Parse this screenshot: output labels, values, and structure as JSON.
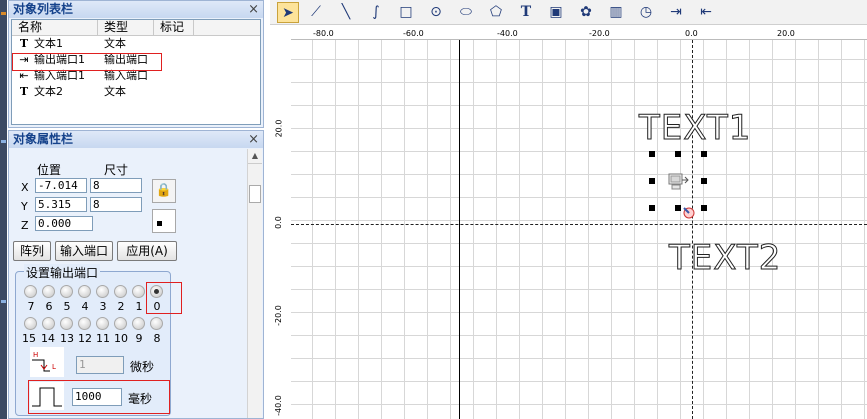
{
  "object_list": {
    "title": "对象列表栏",
    "close": "×",
    "columns": [
      "名称",
      "类型",
      "标记"
    ],
    "rows": [
      {
        "icon": "T",
        "name": "文本1",
        "type": "文本"
      },
      {
        "icon": "⇥",
        "name": "输出端口1",
        "type": "输出端口"
      },
      {
        "icon": "⇤",
        "name": "输入端口1",
        "type": "输入端口"
      },
      {
        "icon": "T",
        "name": "文本2",
        "type": "文本"
      }
    ]
  },
  "properties": {
    "title": "对象属性栏",
    "close": "×",
    "position_label": "位置",
    "size_label": "尺寸",
    "x_label": "X",
    "y_label": "Y",
    "z_label": "Z",
    "x_value": "-7.014",
    "y_value": "5.315",
    "z_value": "0.000",
    "width_value": "8",
    "height_value": "8",
    "buttons": {
      "array": "阵列",
      "input_port": "输入端口",
      "apply": "应用(A)"
    },
    "output_group": {
      "title": "设置输出端口",
      "row1": [
        "7",
        "6",
        "5",
        "4",
        "3",
        "2",
        "1",
        "0"
      ],
      "row2": [
        "15",
        "14",
        "13",
        "12",
        "11",
        "10",
        "9",
        "8"
      ],
      "selected_port": "0",
      "pulse_value": "1",
      "pulse_unit": "微秒",
      "level_h": "H",
      "level_l": "L",
      "delay_value": "1000",
      "delay_unit": "毫秒"
    }
  },
  "ruler": {
    "h_ticks": [
      "-80.0",
      "-60.0",
      "-40.0",
      "-20.0",
      "0.0",
      "20.0"
    ],
    "v_ticks": [
      "20.0",
      "0.0",
      "-20.0",
      "-40.0"
    ]
  },
  "canvas": {
    "text1": "TEXT1",
    "text2": "TEXT2"
  },
  "colors": {
    "accent_red": "#e02020",
    "panel_title": "#15428b"
  }
}
